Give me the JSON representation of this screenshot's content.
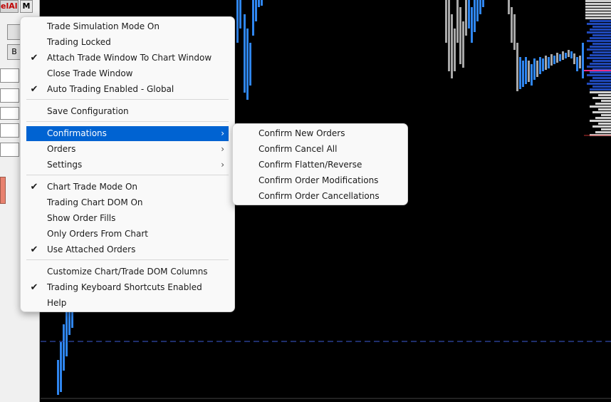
{
  "left_panel": {
    "cancel_all_label": "elAll",
    "m_label": "M",
    "b_label": "B"
  },
  "main_menu": {
    "items": [
      {
        "label": "Trade Simulation Mode On",
        "checked": false
      },
      {
        "label": "Trading Locked",
        "checked": false
      },
      {
        "label": "Attach Trade Window To Chart Window",
        "checked": true
      },
      {
        "label": "Close Trade Window",
        "checked": false
      },
      {
        "label": "Auto Trading Enabled - Global",
        "checked": true
      },
      {
        "label": "Save Configuration",
        "checked": false
      },
      {
        "label": "Confirmations",
        "checked": false,
        "submenu": true,
        "highlighted": true
      },
      {
        "label": "Orders",
        "checked": false,
        "submenu": true
      },
      {
        "label": "Settings",
        "checked": false,
        "submenu": true
      },
      {
        "label": "Chart Trade Mode On",
        "checked": true
      },
      {
        "label": "Trading Chart DOM On",
        "checked": false
      },
      {
        "label": "Show Order Fills",
        "checked": false
      },
      {
        "label": "Only Orders From Chart",
        "checked": false
      },
      {
        "label": "Use Attached Orders",
        "checked": true
      },
      {
        "label": "Customize Chart/Trade DOM Columns",
        "checked": false
      },
      {
        "label": "Trading Keyboard Shortcuts Enabled",
        "checked": true
      },
      {
        "label": "Help",
        "checked": false
      }
    ],
    "check_glyph": "✔",
    "arrow_glyph": "›"
  },
  "confirmations_submenu": {
    "items": [
      {
        "label": "Confirm New Orders"
      },
      {
        "label": "Confirm Cancel All"
      },
      {
        "label": "Confirm Flatten/Reverse"
      },
      {
        "label": "Confirm Order Modifications"
      },
      {
        "label": "Confirm Order Cancellations"
      }
    ]
  },
  "colors": {
    "highlight": "#0063d2",
    "up_bar": "#2f86f0",
    "down_bar": "#a8a8a8",
    "dashed_line": "#3b5bd6",
    "profile_blue": "#1f48b8",
    "profile_line": "#e8308a"
  }
}
